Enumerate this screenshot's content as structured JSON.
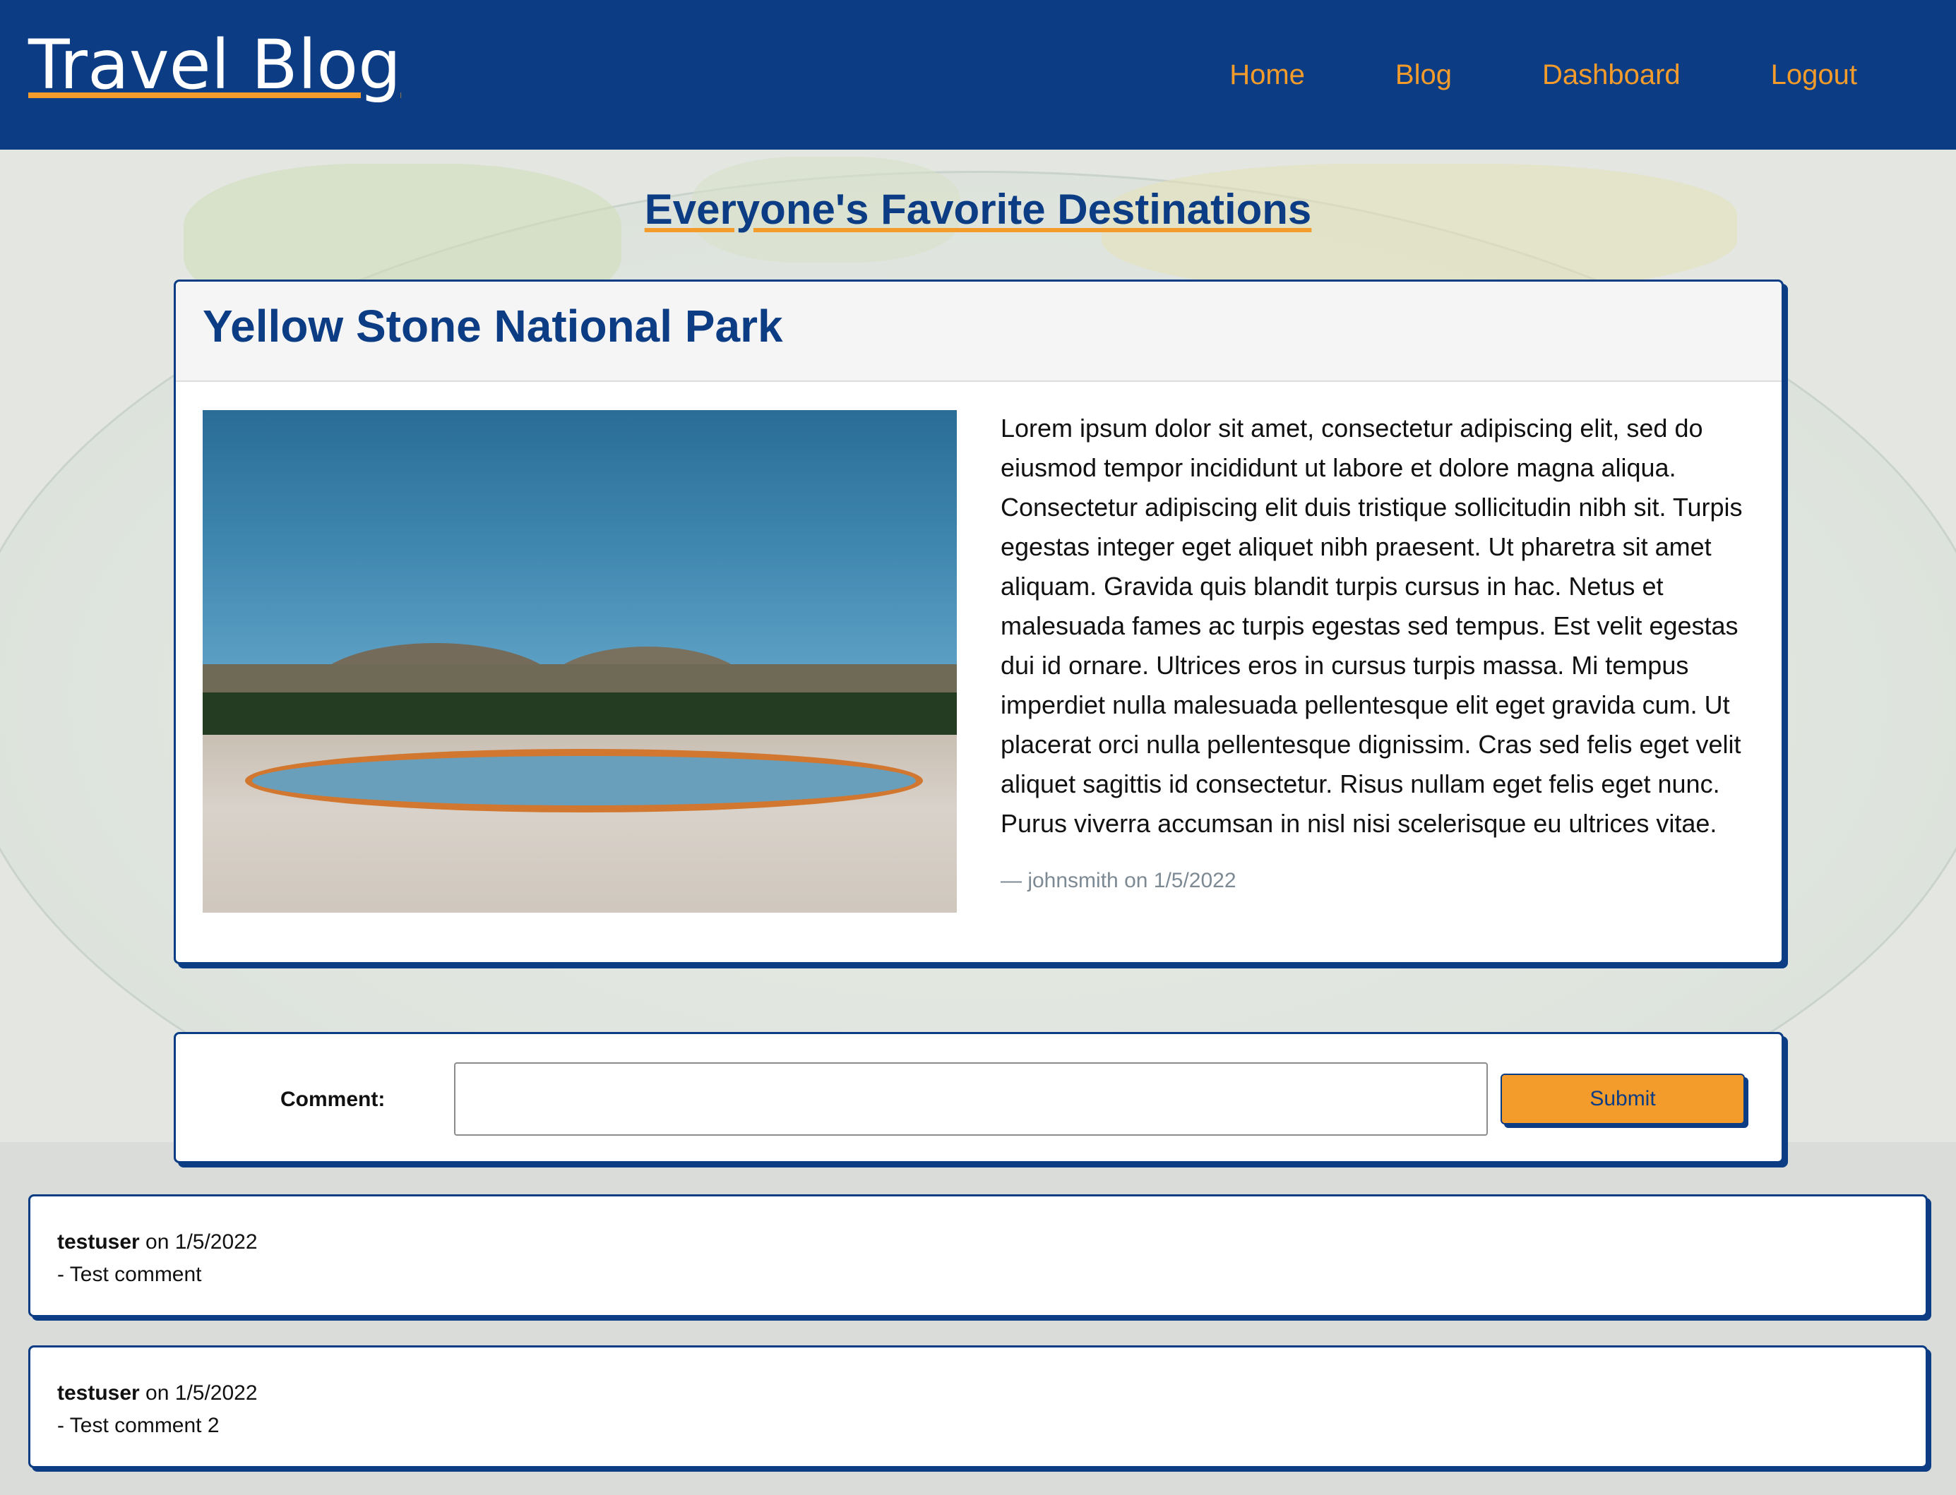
{
  "header": {
    "brand": "Travel Blog",
    "nav": [
      "Home",
      "Blog",
      "Dashboard",
      "Logout"
    ]
  },
  "page_title": "Everyone's Favorite Destinations",
  "post": {
    "title": "Yellow Stone National Park",
    "body": "Lorem ipsum dolor sit amet, consectetur adipiscing elit, sed do eiusmod tempor incididunt ut labore et dolore magna aliqua. Consectetur adipiscing elit duis tristique sollicitudin nibh sit. Turpis egestas integer eget aliquet nibh praesent. Ut pharetra sit amet aliquam. Gravida quis blandit turpis cursus in hac. Netus et malesuada fames ac turpis egestas sed tempus. Est velit egestas dui id ornare. Ultrices eros in cursus turpis massa. Mi tempus imperdiet nulla malesuada pellentesque elit eget gravida cum. Ut placerat orci nulla pellentesque dignissim. Cras sed felis eget velit aliquet sagittis id consectetur. Risus nullam eget felis eget nunc. Purus viverra accumsan in nisl nisi scelerisque eu ultrices vitae.",
    "meta": "— johnsmith on 1/5/2022"
  },
  "comment_form": {
    "label": "Comment:",
    "value": "",
    "placeholder": "",
    "submit_label": "Submit"
  },
  "comments": [
    {
      "author": "testuser",
      "date_text": " on 1/5/2022",
      "text": "- Test comment"
    },
    {
      "author": "testuser",
      "date_text": " on 1/5/2022",
      "text": "- Test comment 2"
    }
  ],
  "colors": {
    "brand_blue": "#0b3c84",
    "accent_orange": "#f39c2b"
  }
}
